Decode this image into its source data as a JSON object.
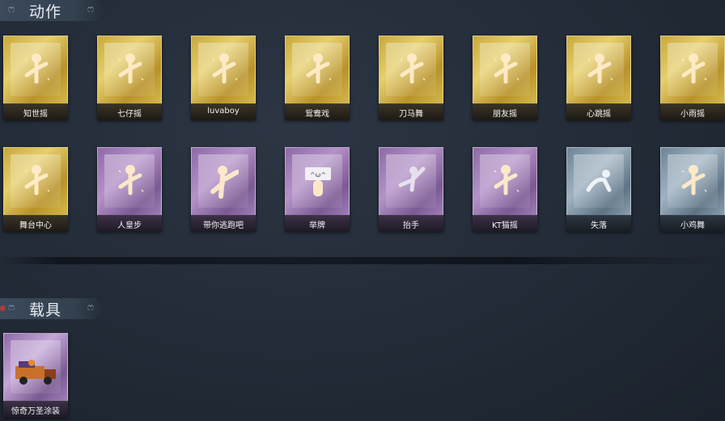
{
  "sections": {
    "actions": {
      "title": "动作"
    },
    "vehicles": {
      "title": "载具"
    }
  },
  "actions": [
    {
      "label": "知世摇",
      "rarity": "gold",
      "icon": "dance-figure-icon"
    },
    {
      "label": "七仔摇",
      "rarity": "gold",
      "icon": "dance-figure-icon"
    },
    {
      "label": "luvaboy",
      "rarity": "gold",
      "icon": "dance-figure-icon"
    },
    {
      "label": "鸳鸯戏",
      "rarity": "gold",
      "icon": "dance-figure-icon"
    },
    {
      "label": "刀马舞",
      "rarity": "gold",
      "icon": "dance-figure-icon"
    },
    {
      "label": "朋友摇",
      "rarity": "gold",
      "icon": "dance-figure-icon"
    },
    {
      "label": "心跳摇",
      "rarity": "gold",
      "icon": "dance-figure-icon"
    },
    {
      "label": "小雨摇",
      "rarity": "gold",
      "icon": "dance-figure-icon"
    },
    {
      "label": "舞台中心",
      "rarity": "gold",
      "icon": "dance-figure-icon"
    },
    {
      "label": "人皇步",
      "rarity": "purple",
      "icon": "dance-figure-icon"
    },
    {
      "label": "带你逃跑吧",
      "rarity": "purple",
      "icon": "pointing-figure-icon"
    },
    {
      "label": "举牌",
      "rarity": "purple",
      "icon": "sign-holding-icon"
    },
    {
      "label": "抬手",
      "rarity": "purple",
      "icon": "raise-hand-icon"
    },
    {
      "label": "KT猫摇",
      "rarity": "purple",
      "icon": "dance-figure-icon"
    },
    {
      "label": "失落",
      "rarity": "blue",
      "icon": "crawling-figure-icon"
    },
    {
      "label": "小鸡舞",
      "rarity": "blue",
      "icon": "dance-figure-icon"
    }
  ],
  "vehicles": [
    {
      "label": "惊奇万圣涂装",
      "rarity": "purple",
      "icon": "truck-icon"
    }
  ],
  "colors": {
    "gold": "#d4b94c",
    "purple": "#a07fb8",
    "blue": "#8aa0b1",
    "background": "#222b37"
  }
}
